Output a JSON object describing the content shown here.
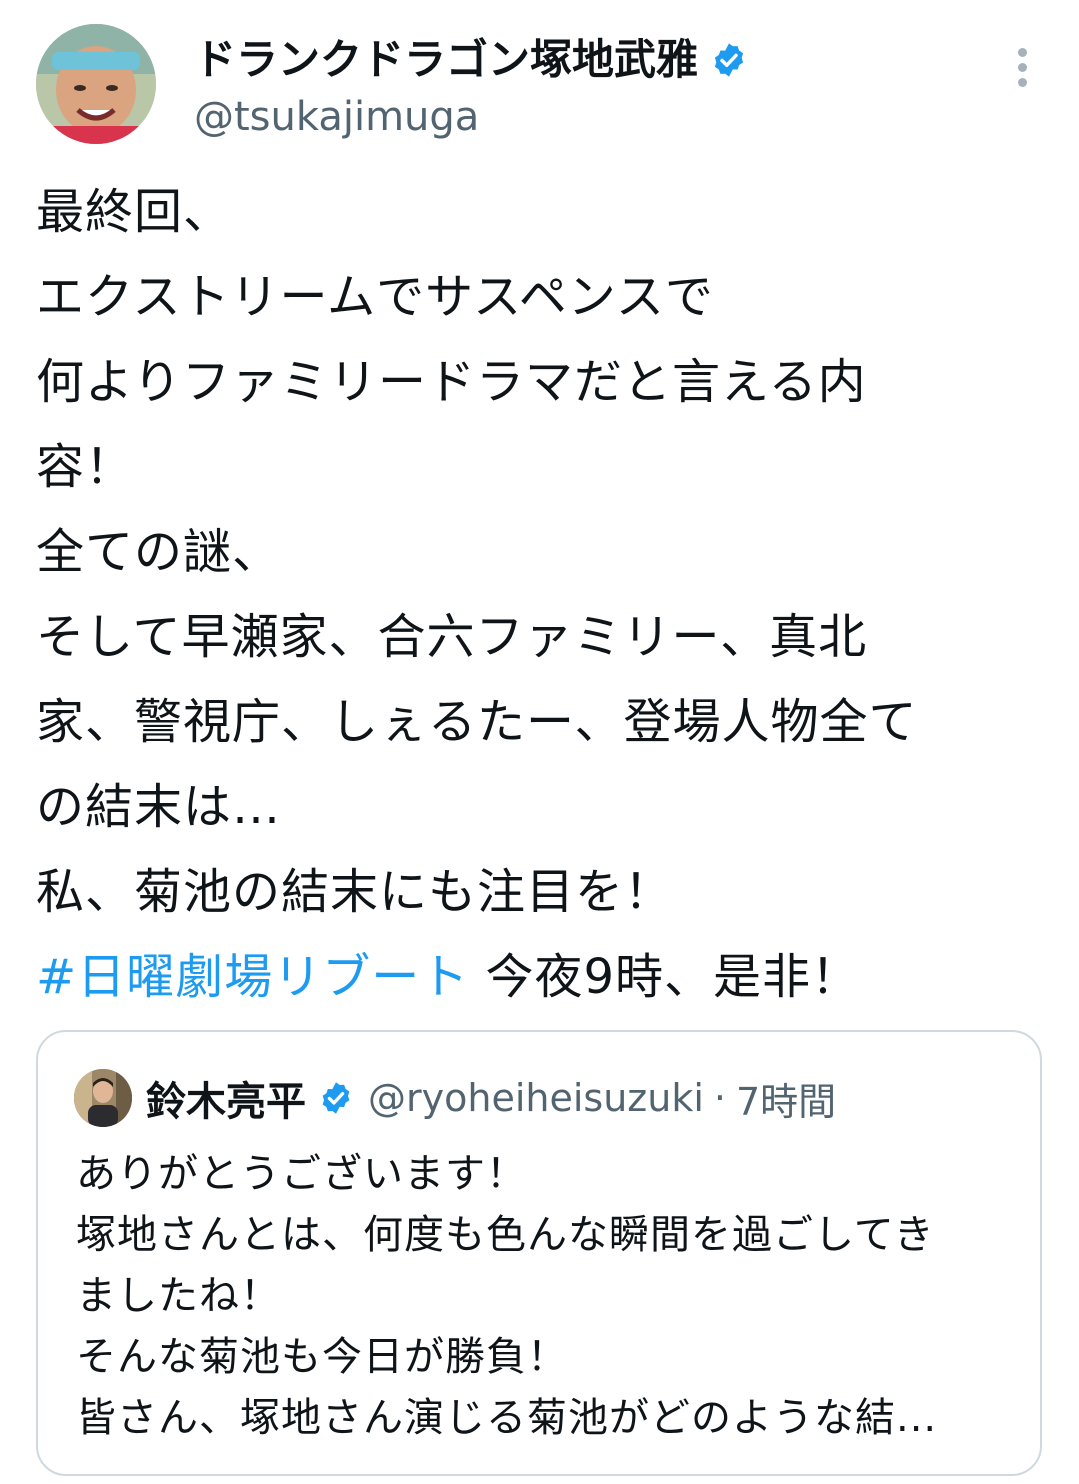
{
  "author": {
    "display_name": "ドランクドラゴン塚地武雅",
    "handle": "@tsukajimuga",
    "verified": true
  },
  "tweet": {
    "lines": [
      "最終回、",
      "エクストリームでサスペンスで",
      "何よりファミリードラマだと言える内",
      "容！",
      "全ての謎、",
      "そして早瀬家、合六ファミリー、真北",
      "家、警視庁、しぇるたー、登場人物全て",
      "の結末は…",
      "私、菊池の結末にも注目を！"
    ],
    "hashtag": "#日曜劇場リブート",
    "hashtag_suffix": " 今夜9時、是非！"
  },
  "quoted": {
    "display_name": "鈴木亮平",
    "handle": "@ryoheiheisuzuki",
    "separator": "·",
    "time": "7時間",
    "lines": [
      "ありがとうございます！",
      "塚地さんとは、何度も色んな瞬間を過ごしてき",
      "ましたね！",
      "そんな菊池も今日が勝負！",
      "皆さん、塚地さん演じる菊池がどのような結..."
    ]
  },
  "colors": {
    "link": "#1d9bf0",
    "verified": "#1d9bf0",
    "secondary_text": "#536471",
    "border": "#cfd9de"
  },
  "icons": {
    "verified": "verified-badge-icon",
    "more": "more-vertical-icon"
  }
}
